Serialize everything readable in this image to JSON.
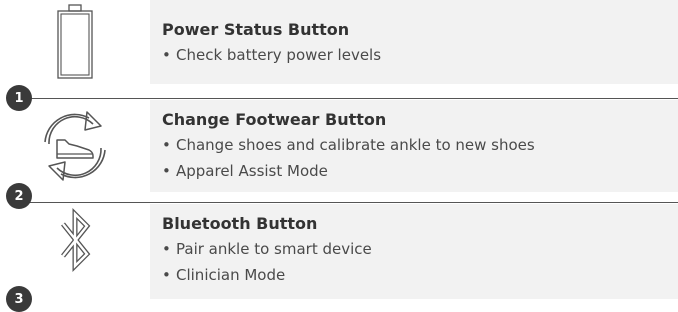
{
  "items": [
    {
      "title": "Power Status Button",
      "bullets": [
        "Check battery power levels"
      ],
      "icon": "battery-icon",
      "number": "1"
    },
    {
      "title": "Change Footwear Button",
      "bullets": [
        "Change shoes and calibrate ankle to new shoes",
        "Apparel Assist Mode"
      ],
      "icon": "shoe-cycle-icon",
      "number": "2"
    },
    {
      "title": "Bluetooth Button",
      "bullets": [
        "Pair ankle to smart device",
        "Clinician Mode"
      ],
      "icon": "bluetooth-icon",
      "number": "3"
    }
  ],
  "bullet_char": "•",
  "colors": {
    "panel": "#f2f2f2",
    "text": "#3a3a3a",
    "badge": "#3a3a3a"
  }
}
